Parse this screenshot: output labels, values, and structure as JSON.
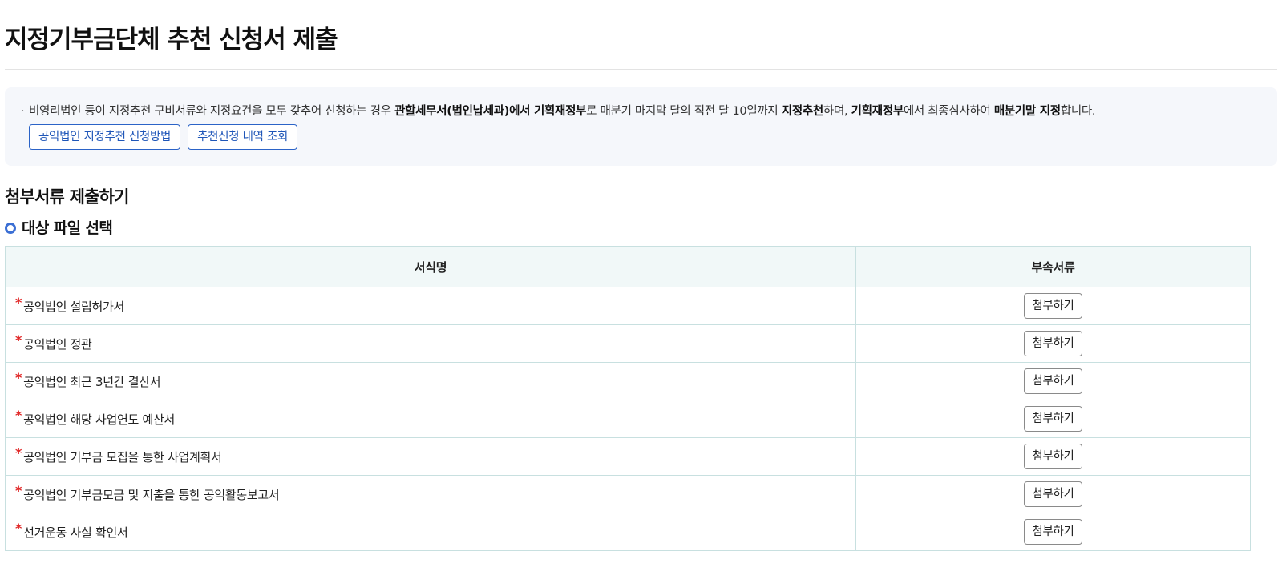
{
  "page": {
    "title": "지정기부금단체 추천 신청서 제출"
  },
  "info": {
    "segments": [
      {
        "text": "비영리법인 등이 지정추천 구비서류와 지정요건을 모두 갖추어 신청하는 경우 ",
        "bold": false
      },
      {
        "text": "관할세무서(법인납세과)에서 기획재정부",
        "bold": true
      },
      {
        "text": "로 매분기 마지막 달의 직전 달 10일까지 ",
        "bold": false
      },
      {
        "text": "지정추천",
        "bold": true
      },
      {
        "text": "하며, ",
        "bold": false
      },
      {
        "text": "기획재정부",
        "bold": true
      },
      {
        "text": "에서 최종심사하여 ",
        "bold": false
      },
      {
        "text": "매분기말 지정",
        "bold": true
      },
      {
        "text": "합니다.",
        "bold": false
      }
    ],
    "buttons": {
      "method_label": "공익법인 지정추천 신청방법",
      "history_label": "추천신청 내역 조회"
    },
    "accent_color": "#2b63c7"
  },
  "attachments": {
    "section_title": "첨부서류 제출하기",
    "sub_title": "대상 파일 선택",
    "table": {
      "columns": [
        "서식명",
        "부속서류"
      ],
      "required_mark": "*",
      "attach_label": "첨부하기",
      "rows": [
        {
          "name": "공익법인 설립허가서"
        },
        {
          "name": "공익법인 정관"
        },
        {
          "name": "공익법인 최근 3년간 결산서"
        },
        {
          "name": "공익법인 해당 사업연도 예산서"
        },
        {
          "name": "공익법인 기부금 모집을 통한 사업계획서"
        },
        {
          "name": "공익법인 기부금모금 및 지출을 통한 공익활동보고서"
        },
        {
          "name": "선거운동 사실 확인서"
        }
      ]
    }
  }
}
